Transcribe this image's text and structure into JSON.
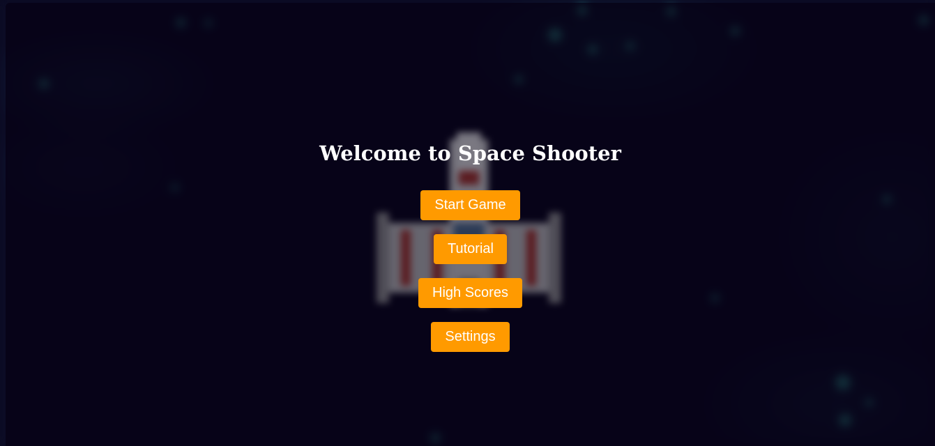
{
  "menu": {
    "title": "Welcome to Space Shooter",
    "buttons": {
      "start": "Start Game",
      "tutorial": "Tutorial",
      "high_scores": "High Scores",
      "settings": "Settings"
    }
  },
  "colors": {
    "button_bg": "#ff9a00",
    "button_text": "#ffffff",
    "title_text": "#ffffff",
    "overlay": "#060014",
    "star_glow": "#3fd9c0"
  }
}
